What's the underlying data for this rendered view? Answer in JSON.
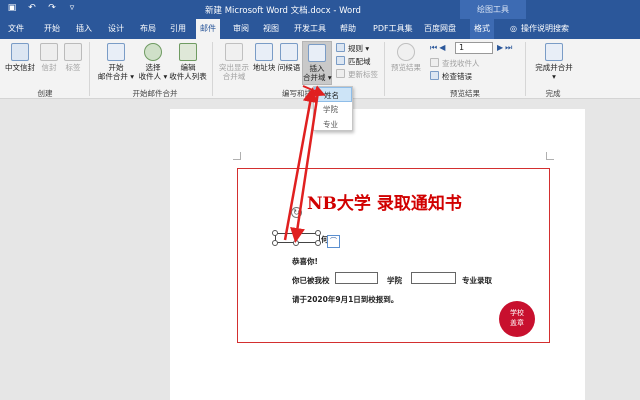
{
  "titlebar": {
    "doc_title": "新建 Microsoft Word 文档.docx  -  Word",
    "context_tools": "绘图工具",
    "qat": {
      "save_icon": "save-icon",
      "undo_icon": "undo-icon",
      "redo_icon": "redo-icon",
      "customize_icon": "customize-icon"
    }
  },
  "tabs": [
    {
      "label": "文件"
    },
    {
      "label": "开始"
    },
    {
      "label": "插入"
    },
    {
      "label": "设计"
    },
    {
      "label": "布局"
    },
    {
      "label": "引用"
    },
    {
      "label": "邮件"
    },
    {
      "label": "审阅"
    },
    {
      "label": "视图"
    },
    {
      "label": "开发工具"
    },
    {
      "label": "帮助"
    },
    {
      "label": "PDF工具集"
    },
    {
      "label": "百度网盘"
    },
    {
      "label": "格式"
    }
  ],
  "tell_me": "操作说明搜索",
  "ribbon": {
    "create": {
      "label": "创建",
      "chinese_envelope": "中文信封",
      "envelope": "信封",
      "labels": "标签"
    },
    "start_merge": {
      "label": "开始邮件合并",
      "start_line1": "开始",
      "start_line2": "邮件合并 ▾",
      "select_line1": "选择",
      "select_line2": "收件人 ▾",
      "edit_line1": "编辑",
      "edit_line2": "收件人列表"
    },
    "write_insert": {
      "label": "编写和插",
      "highlight_line1": "突出显示",
      "highlight_line2": "合并域",
      "address_block": "地址块",
      "greeting_line": "问候语",
      "insert_line1": "插入",
      "insert_line2": "合并域 ▾",
      "rules": "规则 ▾",
      "match_fields": "匹配域",
      "update_labels": "更新标签"
    },
    "preview": {
      "label": "预览结果",
      "preview_results": "预览结果",
      "record": "1",
      "find_recipient": "查找收件人",
      "check_errors": "检查错误"
    },
    "finish": {
      "label": "完成",
      "finish_line1": "完成并合并",
      "finish_line2": "▾"
    }
  },
  "dropdown": {
    "items": [
      "姓名",
      "学院",
      "专业"
    ]
  },
  "document": {
    "title": "NB大学 录取通知书",
    "greeting": "恭喜你!",
    "line2_a": "你已被我校",
    "line2_b": "学院",
    "line2_c": "专业录取",
    "line3": "请于2020年9月1日到校报到。",
    "seal_line1": "学校",
    "seal_line2": "盖章",
    "textbox_text": "何"
  },
  "colors": {
    "word_blue": "#2b579a",
    "annotation_red": "#e02020",
    "seal_red": "#c8102e"
  }
}
